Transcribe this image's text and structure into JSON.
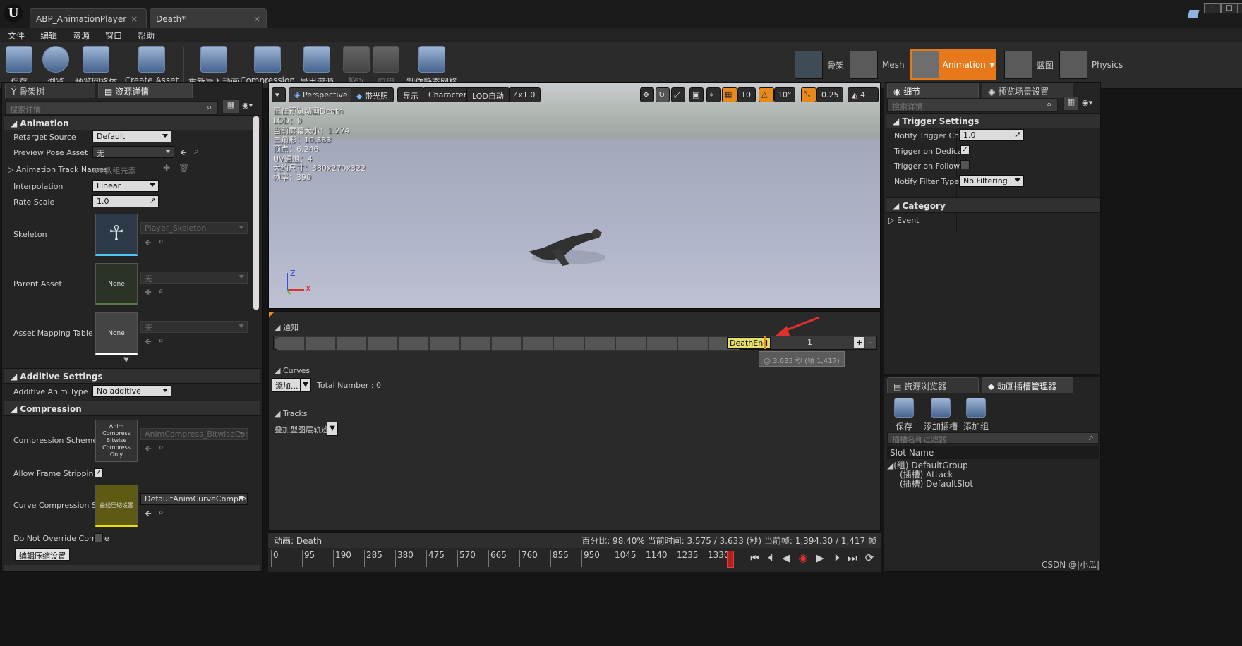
{
  "titlebar": {
    "tabs": [
      {
        "label": "ABP_AnimationPlayer"
      },
      {
        "label": "Death*"
      }
    ]
  },
  "menu": [
    "文件",
    "编辑",
    "资源",
    "窗口",
    "帮助"
  ],
  "toolbar": {
    "items": [
      "保存",
      "浏览",
      "预览网格体",
      "Create Asset",
      "重新导入动画",
      "Compression",
      "导出资源",
      "Key",
      "应用",
      "制作静态网格体"
    ]
  },
  "modes": {
    "skeleton": "骨架",
    "mesh": "Mesh",
    "animation": "Animation",
    "blueprint": "蓝图",
    "physics": "Physics"
  },
  "left": {
    "tabs": [
      "骨架树",
      "资源详情"
    ],
    "search_placeholder": "搜索详情",
    "animation": {
      "title": "Animation",
      "retarget_source_label": "Retarget Source",
      "retarget_source": "Default",
      "preview_pose_label": "Preview Pose Asset",
      "preview_pose": "无",
      "track_names_label": "Animation Track Names",
      "track_names": "65 数组元素",
      "interpolation_label": "Interpolation",
      "interpolation": "Linear",
      "rate_scale_label": "Rate Scale",
      "rate_scale": "1.0",
      "skeleton_label": "Skeleton",
      "skeleton": "Player_Skeleton",
      "parent_asset_label": "Parent Asset",
      "parent_asset": "无",
      "parent_thumb": "None",
      "mapping_label": "Asset Mapping Table",
      "mapping": "无",
      "mapping_thumb": "None"
    },
    "additive": {
      "title": "Additive Settings",
      "type_label": "Additive Anim Type",
      "type": "No additive"
    },
    "compression": {
      "title": "Compression",
      "scheme_label": "Compression Scheme",
      "scheme": "AnimCompress_BitwiseCompre",
      "scheme_thumb": "Anim Compress Bitwise Compress Only",
      "frame_strip_label": "Allow Frame Stripping",
      "curve_label": "Curve Compression Sett",
      "curve": "DefaultAnimCurveCompression",
      "curve_thumb": "曲线压缩设置",
      "override_label": "Do Not Override Compre",
      "edit_button": "编辑压缩设置"
    }
  },
  "viewport": {
    "buttons": {
      "perspective": "Perspective",
      "lit": "带光照",
      "show": "显示",
      "character": "Character",
      "lod": "LOD自动",
      "speed": "x1.0"
    },
    "grid_snap": "10",
    "rot_snap": "10°",
    "scale_snap": "0.25",
    "cam_speed": "4",
    "stats": [
      "正在预览动画Death",
      "LOD：0",
      "当前屏幕大小：1.274",
      "三角形：10,383",
      "顶点：6,246",
      "UV通道：4",
      "大约尺寸：380x270x322",
      "帧率：390"
    ],
    "axis_x": "X",
    "axis_z": "Z"
  },
  "timeline": {
    "notify_title": "通知",
    "notify_label": "DeathEnd",
    "notify_track": "1",
    "tooltip": "@ 3.633 秒 (帧 1,417)",
    "curves_title": "Curves",
    "add_button": "添加...",
    "total": "Total Number : 0",
    "tracks_title": "Tracks",
    "track_label": "叠加型图层轨迹"
  },
  "footer": {
    "anim": "动画:  Death",
    "info": "百分比: 98.40%  当前时间: 3.575 / 3.633 (秒)  当前帧: 1,394.30 / 1,417 帧"
  },
  "scrub": {
    "ticks": [
      "0",
      "95",
      "190",
      "285",
      "380",
      "475",
      "570",
      "665",
      "760",
      "855",
      "950",
      "1045",
      "1140",
      "1235",
      "1330"
    ]
  },
  "right": {
    "tabs": [
      "细节",
      "预览场景设置"
    ],
    "search_placeholder": "搜索详情",
    "trigger": {
      "title": "Trigger Settings",
      "chance_label": "Notify Trigger Chan",
      "chance": "1.0",
      "dedicated_label": "Trigger on Dedicate",
      "follower_label": "Trigger on Follower",
      "filter_label": "Notify Filter Type",
      "filter": "No Filtering"
    },
    "category": {
      "title": "Category",
      "event": "Event"
    }
  },
  "slots": {
    "tabs": [
      "资源浏览器",
      "动画插槽管理器"
    ],
    "buttons": [
      "保存",
      "添加插槽",
      "添加组"
    ],
    "filter_placeholder": "插槽名称过滤器",
    "header": "Slot Name",
    "tree": [
      "(组) DefaultGroup",
      "(插槽) Attack",
      "(插槽) DefaultSlot"
    ]
  },
  "watermark": "CSDN @|小瓜|"
}
